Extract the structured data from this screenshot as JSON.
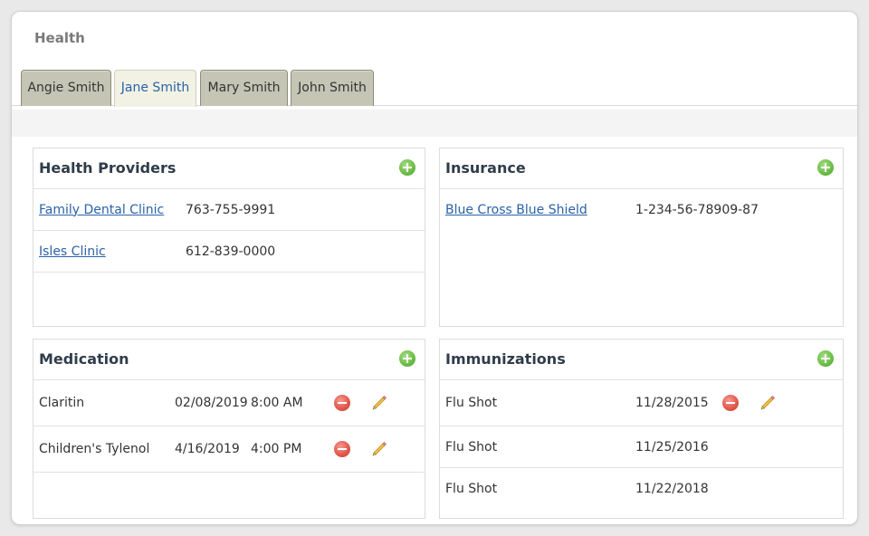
{
  "page": {
    "title": "Health"
  },
  "tabs": [
    {
      "label": "Angie Smith"
    },
    {
      "label": "Jane Smith"
    },
    {
      "label": "Mary Smith"
    },
    {
      "label": "John Smith"
    }
  ],
  "providers": {
    "title": "Health Providers",
    "rows": [
      {
        "name": "Family Dental Clinic",
        "phone": "763-755-9991"
      },
      {
        "name": "Isles Clinic",
        "phone": "612-839-0000"
      }
    ]
  },
  "insurance": {
    "title": "Insurance",
    "rows": [
      {
        "name": "Blue Cross Blue Shield",
        "number": "1-234-56-78909-87"
      }
    ]
  },
  "medication": {
    "title": "Medication",
    "rows": [
      {
        "name": "Claritin",
        "date": "02/08/2019",
        "time": "8:00 AM"
      },
      {
        "name": "Children's Tylenol",
        "date": "4/16/2019",
        "time": "4:00 PM"
      }
    ]
  },
  "immunizations": {
    "title": "Immunizations",
    "rows": [
      {
        "name": "Flu Shot",
        "date": "11/28/2015"
      },
      {
        "name": "Flu Shot",
        "date": "11/25/2016"
      },
      {
        "name": "Flu Shot",
        "date": "11/22/2018"
      }
    ]
  },
  "icons": {
    "add": "plus-circle-icon",
    "remove": "minus-circle-icon",
    "edit": "pencil-icon"
  },
  "colors": {
    "link": "#2a62a8",
    "add": "#6fbf4a",
    "remove": "#e35a4c",
    "tab_inactive": "#c5c5b5",
    "tab_active": "#f2f2e4"
  }
}
